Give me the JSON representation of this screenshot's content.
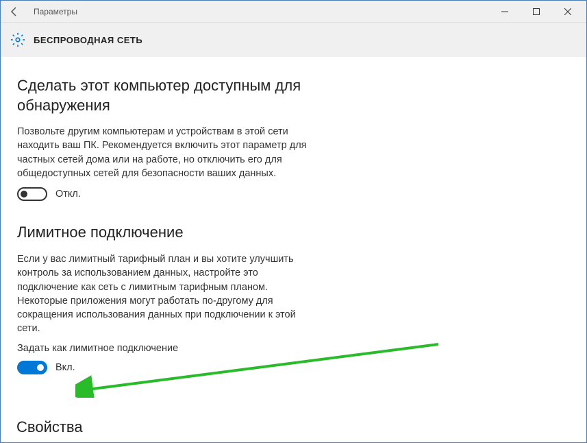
{
  "titlebar": {
    "title": "Параметры"
  },
  "header": {
    "page_title": "БЕСПРОВОДНАЯ СЕТЬ"
  },
  "sections": {
    "discovery": {
      "heading": "Сделать этот компьютер доступным для обнаружения",
      "description": "Позвольте другим компьютерам и устройствам в этой сети находить ваш ПК. Рекомендуется включить этот параметр для частных сетей дома или на работе, но отключить его для общедоступных сетей для безопасности ваших данных.",
      "toggle_label": "Откл."
    },
    "metered": {
      "heading": "Лимитное подключение",
      "description": "Если у вас лимитный тарифный план и вы хотите улучшить контроль за использованием данных, настройте это подключение как сеть с лимитным тарифным планом. Некоторые приложения могут работать по-другому для сокращения использования данных при подключении к этой сети.",
      "sub_label": "Задать как лимитное подключение",
      "toggle_label": "Вкл."
    },
    "properties": {
      "heading": "Свойства"
    }
  }
}
